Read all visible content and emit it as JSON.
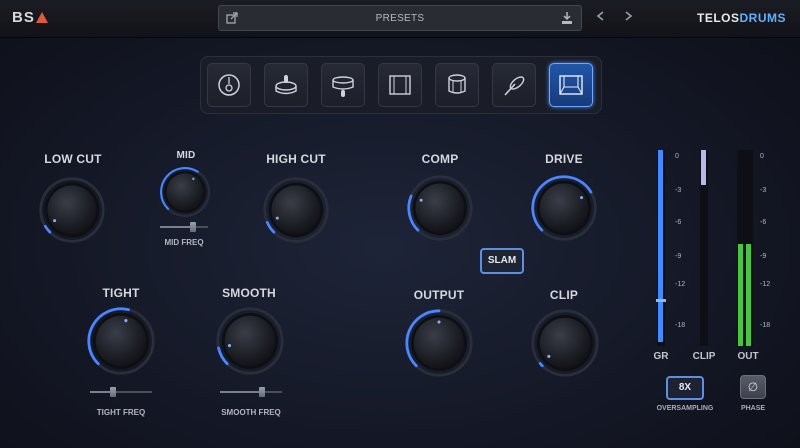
{
  "header": {
    "logo": "BS",
    "presets_label": "PRESETS",
    "brand_main": "TELOS",
    "brand_accent": "DRUMS"
  },
  "mic_positions": [
    {
      "icon": "kick-drum-icon",
      "active": false
    },
    {
      "icon": "snare-top-icon",
      "active": false
    },
    {
      "icon": "snare-side-icon",
      "active": false
    },
    {
      "icon": "room-square-icon",
      "active": false
    },
    {
      "icon": "tom-drum-icon",
      "active": false
    },
    {
      "icon": "cymbal-stick-icon",
      "active": false
    },
    {
      "icon": "room-overhead-icon",
      "active": true
    }
  ],
  "knobs": {
    "low_cut": {
      "label": "LOW CUT",
      "value": 0.05
    },
    "mid": {
      "label": "MID",
      "value": 0.62
    },
    "mid_freq": {
      "label": "MID FREQ",
      "value": 0.72
    },
    "high_cut": {
      "label": "HIGH CUT",
      "value": 0.08
    },
    "comp": {
      "label": "COMP",
      "value": 0.25
    },
    "drive": {
      "label": "DRIVE",
      "value": 0.72
    },
    "tight": {
      "label": "TIGHT",
      "value": 0.55
    },
    "tight_freq": {
      "label": "TIGHT FREQ",
      "value": 0.35
    },
    "smooth": {
      "label": "SMOOTH",
      "value": 0.12
    },
    "smooth_freq": {
      "label": "SMOOTH FREQ",
      "value": 0.7
    },
    "output": {
      "label": "OUTPUT",
      "value": 0.5
    },
    "clip": {
      "label": "CLIP",
      "value": 0.02
    }
  },
  "slam_label": "SLAM",
  "meters": {
    "scale": [
      "0",
      "-3",
      "-6",
      "-9",
      "-12",
      "-18"
    ],
    "gr_label": "GR",
    "clip_label": "CLIP",
    "out_label": "OUT",
    "gr_level": 0.98,
    "clip_level": 0.18,
    "out_level": 0.52,
    "colors": {
      "gr": "#3f8cff",
      "clip": "#b9b6ef",
      "out": "#49c443"
    }
  },
  "oversampling": {
    "value": "8X",
    "label": "OVERSAMPLING"
  },
  "phase": {
    "symbol": "∅",
    "label": "PHASE"
  },
  "accent_color": "#4a86ff"
}
